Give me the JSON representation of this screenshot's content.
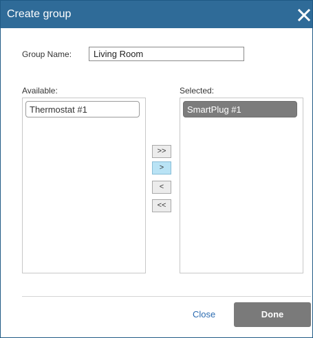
{
  "dialog": {
    "title": "Create group",
    "close_icon": "close-icon"
  },
  "form": {
    "group_name_label": "Group Name:",
    "group_name_value": "Living Room"
  },
  "available": {
    "label": "Available:",
    "items": [
      "Thermostat #1"
    ]
  },
  "selected": {
    "label": "Selected:",
    "items": [
      "SmartPlug #1"
    ]
  },
  "move_buttons": {
    "add_all": ">>",
    "add": ">",
    "remove": "<",
    "remove_all": "<<"
  },
  "footer": {
    "close_label": "Close",
    "done_label": "Done"
  },
  "colors": {
    "titlebar": "#2f6b98",
    "selected_item": "#7c7c7c",
    "active_move_button": "#b9e3f5",
    "done_button": "#7a7a7a",
    "close_link": "#2a6ab0"
  }
}
